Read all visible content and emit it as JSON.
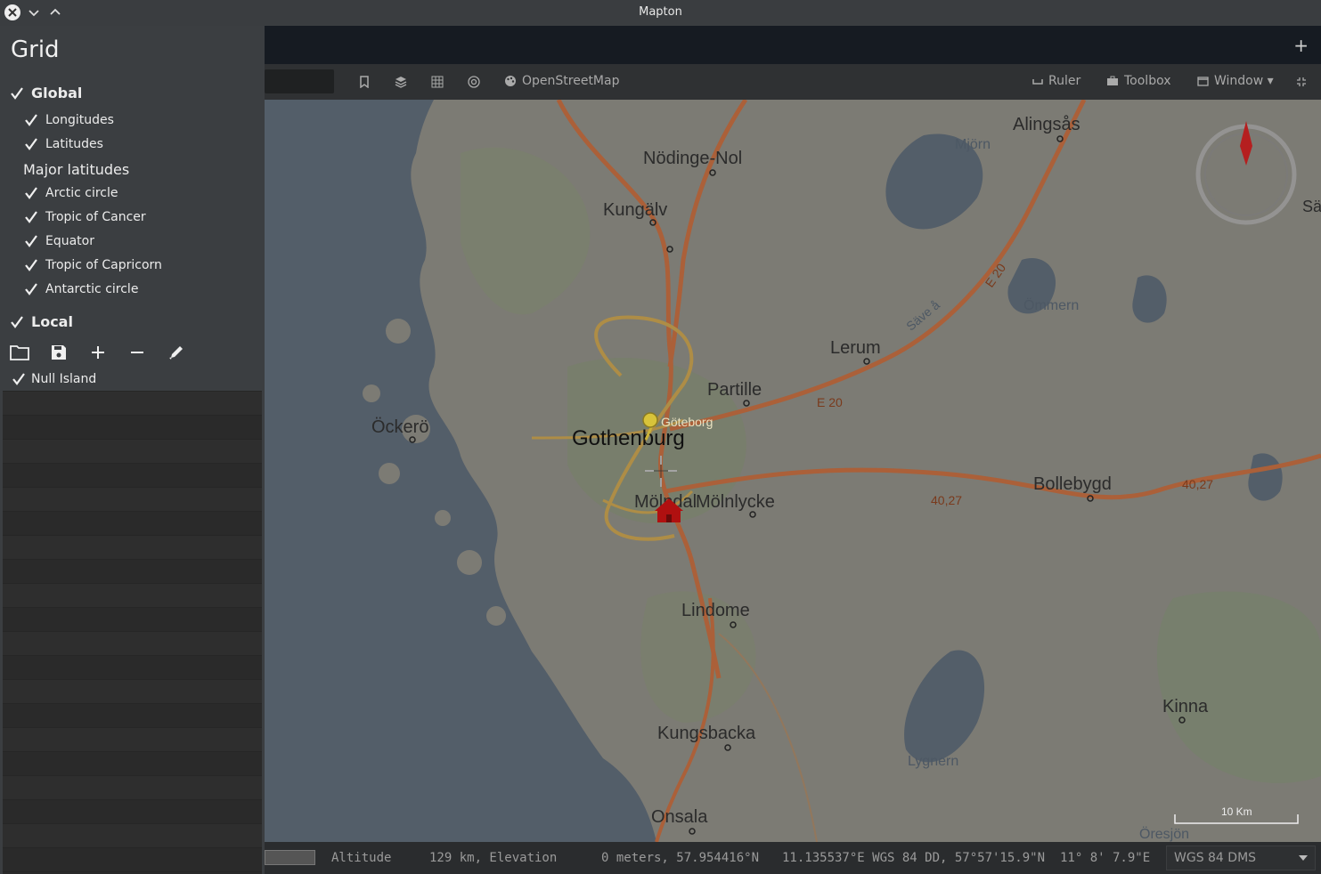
{
  "window": {
    "title": "Mapton"
  },
  "tabbar": {
    "add_label": "+"
  },
  "toolbar": {
    "map_source": "OpenStreetMap",
    "ruler": "Ruler",
    "toolbox": "Toolbox",
    "window": "Window ▾"
  },
  "sidebar": {
    "title": "Grid",
    "global": {
      "label": "Global",
      "checked": true
    },
    "longitudes": "Longitudes",
    "latitudes": "Latitudes",
    "major_latitudes": "Major latitudes",
    "lat_items": [
      "Arctic circle",
      "Tropic of Cancer",
      "Equator",
      "Tropic of Capricorn",
      "Antarctic circle"
    ],
    "local": {
      "label": "Local",
      "checked": true
    },
    "local_items": [
      "Null Island"
    ]
  },
  "map": {
    "places": [
      "Alingsås",
      "Nödinge-Nol",
      "Kungälv",
      "Mjörn",
      "Sävedalen",
      "Ömmern",
      "Lerum",
      "Partille",
      "Öckerö",
      "Gothenburg",
      "Göteborg",
      "Mölndal",
      "Mölnlycke",
      "Bollebygd",
      "Lindome",
      "Kinna",
      "Kungsbacka",
      "Lygnern",
      "Onsala",
      "Öresjön"
    ],
    "roads": [
      "E 20",
      "E 20",
      "40,27",
      "40,27",
      "Säve å"
    ],
    "scale": "10 Km"
  },
  "status": {
    "altitude_label": "Altitude",
    "altitude_value": "129 km, Elevation",
    "elevation_value": "0 meters, 57.954416°N",
    "coords": "11.135537°E WGS 84 DD, 57°57'15.9\"N",
    "dms_lon": "11° 8' 7.9\"E",
    "crs": "WGS 84 DMS"
  },
  "colors": {
    "map_water": "#5a6774",
    "map_land": "#8c8a82",
    "road_primary": "#c5693a",
    "road_secondary": "#c8a04a"
  }
}
